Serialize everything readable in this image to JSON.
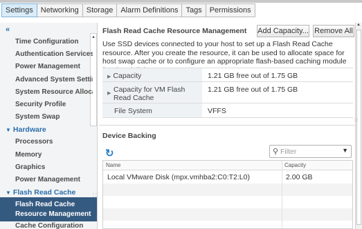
{
  "tabs": [
    {
      "label": "Settings",
      "active": true
    },
    {
      "label": "Networking",
      "active": false
    },
    {
      "label": "Storage",
      "active": false
    },
    {
      "label": "Alarm Definitions",
      "active": false
    },
    {
      "label": "Tags",
      "active": false
    },
    {
      "label": "Permissions",
      "active": false
    }
  ],
  "sidebar": {
    "collapse_icon": "double-chevron-left-icon",
    "collapse_glyph": "«",
    "items": [
      {
        "label": "Time Configuration"
      },
      {
        "label": "Authentication Services"
      },
      {
        "label": "Power Management"
      },
      {
        "label": "Advanced System Settings"
      },
      {
        "label": "System Resource Allocation"
      },
      {
        "label": "Security Profile"
      },
      {
        "label": "System Swap"
      }
    ],
    "hardware": {
      "label": "Hardware",
      "items": [
        {
          "label": "Processors"
        },
        {
          "label": "Memory"
        },
        {
          "label": "Graphics"
        },
        {
          "label": "Power Management"
        }
      ]
    },
    "flash": {
      "label": "Flash Read Cache",
      "selected_label": "Flash Read Cache Resource Management",
      "items": [
        {
          "label": "Cache Configuration"
        }
      ]
    }
  },
  "main": {
    "title": "Flash Read Cache Resource Management",
    "add_button": "Add Capacity...",
    "remove_button": "Remove All",
    "description": "Use SSD devices connected to your host to set up a Flash Read Cache resource. After you create the resource, it can be used to allocate space for host swap cache or to configure an appropriate flash-based caching module for virtual disks.",
    "info_rows": [
      {
        "label": "Capacity",
        "value": "1.21 GB free out of 1.75 GB"
      },
      {
        "label": "Capacity for VM Flash Read Cache",
        "value": "1.21 GB free out of 1.75 GB"
      },
      {
        "label": "File System",
        "value": "VFFS"
      }
    ],
    "device_backing": {
      "title": "Device Backing",
      "filter_placeholder": "Filter",
      "columns": [
        "Name",
        "Capacity"
      ],
      "rows": [
        {
          "name": "Local VMware Disk (mpx.vmhba2:C0:T2:L0)",
          "capacity": "2.00 GB"
        }
      ]
    }
  }
}
